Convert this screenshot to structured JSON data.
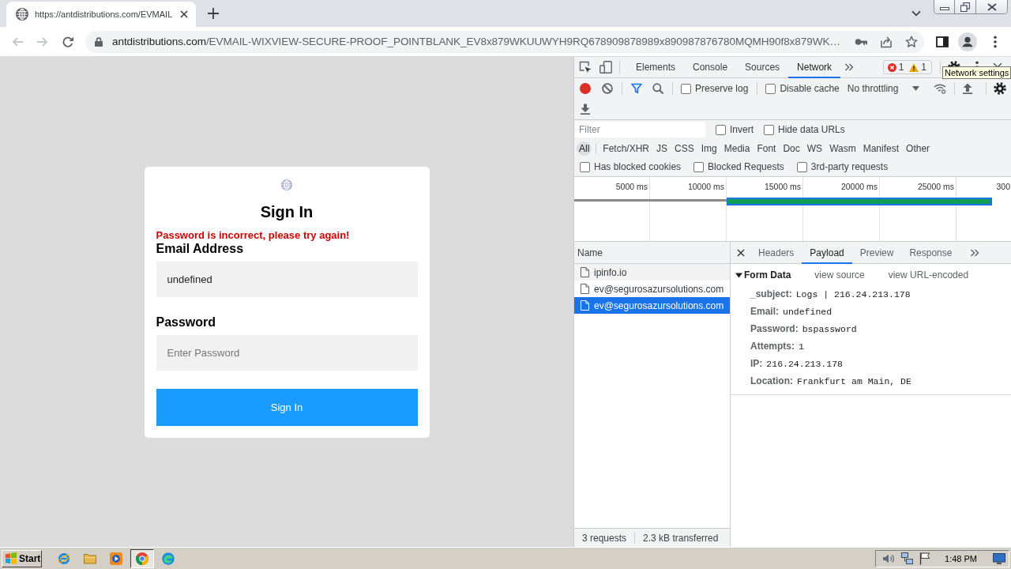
{
  "browser": {
    "tabs": [
      {
        "title": "https://antdistributions.com/EVMAIL",
        "selected": true
      }
    ],
    "navigation": [
      {
        "kind": "back",
        "disabled": true
      },
      {
        "kind": "forward",
        "disabled": true
      },
      {
        "kind": "reload",
        "disabled": false
      }
    ],
    "address": {
      "host": "antdistributions.com",
      "path": "/EVMAIL-WIXVIEW-SECURE-PROOF_POINTBLANK_EV8x879WKUUWYH9RQ678909878989x890987876780MQMH90f8x879WK…"
    }
  },
  "page": {
    "title": "Sign In",
    "error": "Password is incorrect, please try again!",
    "fields": [
      {
        "label": "Email Address",
        "value": "undefined"
      },
      {
        "label": "Password",
        "placeholder": "Enter Password"
      }
    ],
    "button": "Sign In"
  },
  "devtools": {
    "panels": [
      {
        "label": "Elements",
        "selected": false
      },
      {
        "label": "Console",
        "selected": false
      },
      {
        "label": "Sources",
        "selected": false
      },
      {
        "label": "Network",
        "selected": true
      }
    ],
    "issues": {
      "errors": "1",
      "warnings": "1"
    },
    "tooltip": "Network settings",
    "toolbar": {
      "recording": true,
      "options": [
        {
          "label": "Preserve log",
          "checked": false
        },
        {
          "label": "Disable cache",
          "checked": false
        }
      ],
      "throttling": "No throttling"
    },
    "filter": {
      "placeholder": "Filter",
      "options": [
        {
          "label": "Invert",
          "checked": false
        },
        {
          "label": "Hide data URLs",
          "checked": false
        }
      ]
    },
    "types": [
      {
        "label": "All",
        "selected": true
      },
      {
        "label": "Fetch/XHR",
        "selected": false
      },
      {
        "label": "JS",
        "selected": false
      },
      {
        "label": "CSS",
        "selected": false
      },
      {
        "label": "Img",
        "selected": false
      },
      {
        "label": "Media",
        "selected": false
      },
      {
        "label": "Font",
        "selected": false
      },
      {
        "label": "Doc",
        "selected": false
      },
      {
        "label": "WS",
        "selected": false
      },
      {
        "label": "Wasm",
        "selected": false
      },
      {
        "label": "Manifest",
        "selected": false
      },
      {
        "label": "Other",
        "selected": false
      }
    ],
    "more_filters": [
      {
        "label": "Has blocked cookies",
        "checked": false
      },
      {
        "label": "Blocked Requests",
        "checked": false
      },
      {
        "label": "3rd-party requests",
        "checked": false
      }
    ],
    "overview": {
      "ticks": [
        "5000 ms",
        "10000 ms",
        "15000 ms",
        "20000 ms",
        "25000 ms",
        "300"
      ]
    },
    "requests": {
      "column": "Name",
      "rows": [
        {
          "name": "ipinfo.io",
          "selected": false
        },
        {
          "name": "ev@segurosazursolutions.com",
          "selected": false
        },
        {
          "name": "ev@segurosazursolutions.com",
          "selected": true
        }
      ]
    },
    "detail": {
      "tabs": [
        {
          "label": "Headers",
          "selected": false
        },
        {
          "label": "Payload",
          "selected": true
        },
        {
          "label": "Preview",
          "selected": false
        },
        {
          "label": "Response",
          "selected": false
        }
      ],
      "section": {
        "title": "Form Data",
        "expanded": true,
        "links": [
          "view source",
          "view URL-encoded"
        ],
        "fields": [
          {
            "key": "_subject:",
            "value": "Logs | 216.24.213.178"
          },
          {
            "key": "Email:",
            "value": "undefined"
          },
          {
            "key": "Password:",
            "value": "bspassword"
          },
          {
            "key": "Attempts:",
            "value": "1"
          },
          {
            "key": "IP:",
            "value": "216.24.213.178"
          },
          {
            "key": "Location:",
            "value": "Frankfurt am Main, DE"
          }
        ]
      }
    },
    "status": [
      "3 requests",
      "2.3 kB transferred"
    ]
  },
  "taskbar": {
    "start": "Start",
    "launchers": [
      {
        "selected": false
      },
      {
        "selected": false
      },
      {
        "selected": false
      },
      {
        "selected": true
      },
      {
        "selected": false
      }
    ],
    "clock": "1:48 PM"
  }
}
